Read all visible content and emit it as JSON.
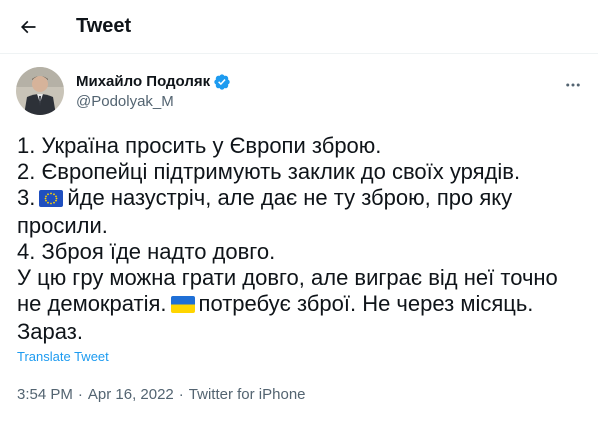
{
  "header": {
    "title": "Tweet",
    "back_icon": "arrow-left-icon"
  },
  "author": {
    "display_name": "Михайло Подоляк",
    "handle": "@Podolyak_M",
    "verified_icon": "verified-badge-icon",
    "verified_color": "#1d9bf0"
  },
  "tweet": {
    "lines": {
      "l1": "1. Україна просить у Європи зброю.",
      "l2": "2. Європейці підтримують заклик до своїх урядів.",
      "l3_prefix": "3.",
      "l3_flag": "eu-flag",
      "l3_text": "йде назустріч, але дає не ту зброю, про яку",
      "l3b": "просили.",
      "l4": "4. Зброя їде надто довго.",
      "p2a": "У цю гру можна грати довго, але виграє від неї точно",
      "p2b_prefix": "не демократія.",
      "p2b_flag": "ukraine-flag",
      "p2b_text": "потребує зброї. Не через місяць.",
      "p2c": "Зараз."
    },
    "translate_label": "Translate Tweet"
  },
  "meta": {
    "time": "3:54 PM",
    "separator": "·",
    "date": "Apr 16, 2022",
    "source": "Twitter for iPhone"
  },
  "colors": {
    "link": "#1d9bf0",
    "secondary_text": "#536471",
    "primary_text": "#0f1419"
  }
}
